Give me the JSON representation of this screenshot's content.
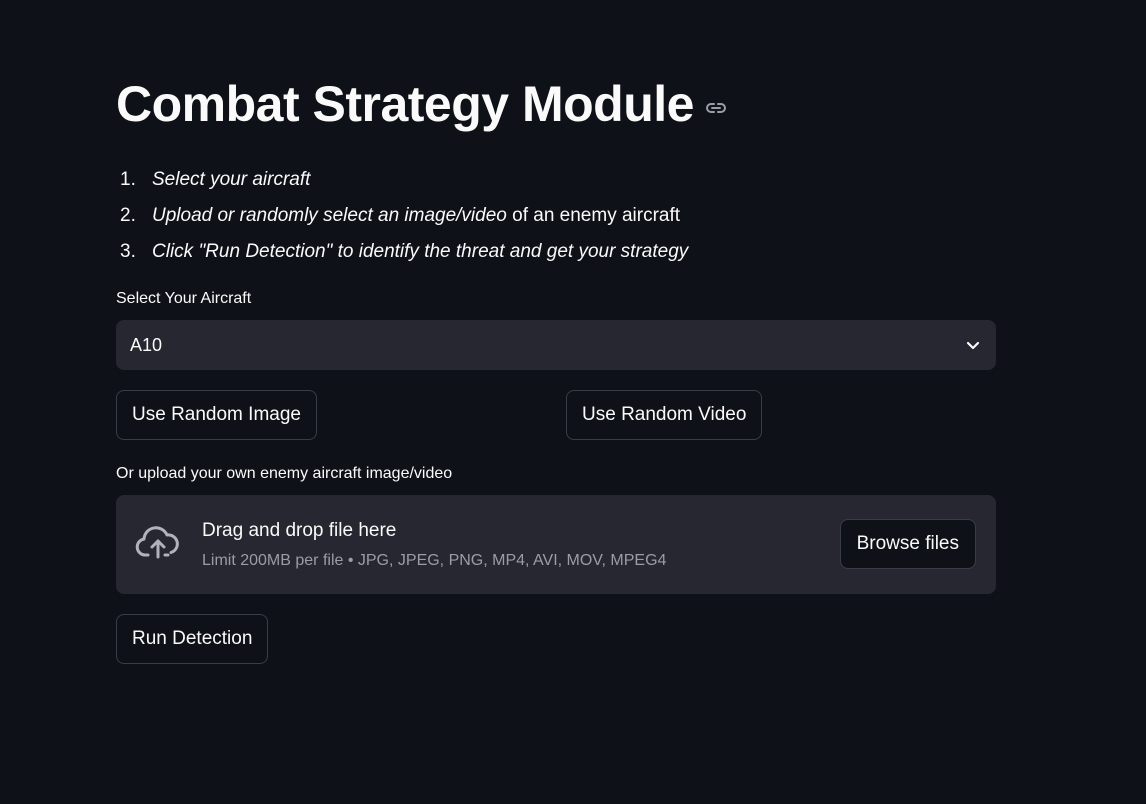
{
  "header": {
    "title": "Combat Strategy Module",
    "link_icon": "link-icon"
  },
  "steps": [
    {
      "num": "1.",
      "italic": "Select your aircraft",
      "plain": ""
    },
    {
      "num": "2.",
      "italic": "Upload or randomly select an image/video",
      "plain": " of an enemy aircraft"
    },
    {
      "num": "3.",
      "italic": "Click \"Run Detection\" to identify the threat and get your strategy",
      "plain": ""
    }
  ],
  "aircraft_select": {
    "label": "Select Your Aircraft",
    "value": "A10",
    "icon": "chevron-down-icon"
  },
  "random_buttons": {
    "image_label": "Use Random Image",
    "video_label": "Use Random Video"
  },
  "uploader": {
    "label": "Or upload your own enemy aircraft image/video",
    "drop_title": "Drag and drop file here",
    "drop_sub": "Limit 200MB per file • JPG, JPEG, PNG, MP4, AVI, MOV, MPEG4",
    "browse_label": "Browse files",
    "icon": "cloud-upload-icon"
  },
  "run_button": {
    "label": "Run Detection"
  },
  "colors": {
    "background": "#0e1117",
    "surface": "#262730",
    "text": "#fafafa",
    "muted": "#9a9ca6"
  }
}
